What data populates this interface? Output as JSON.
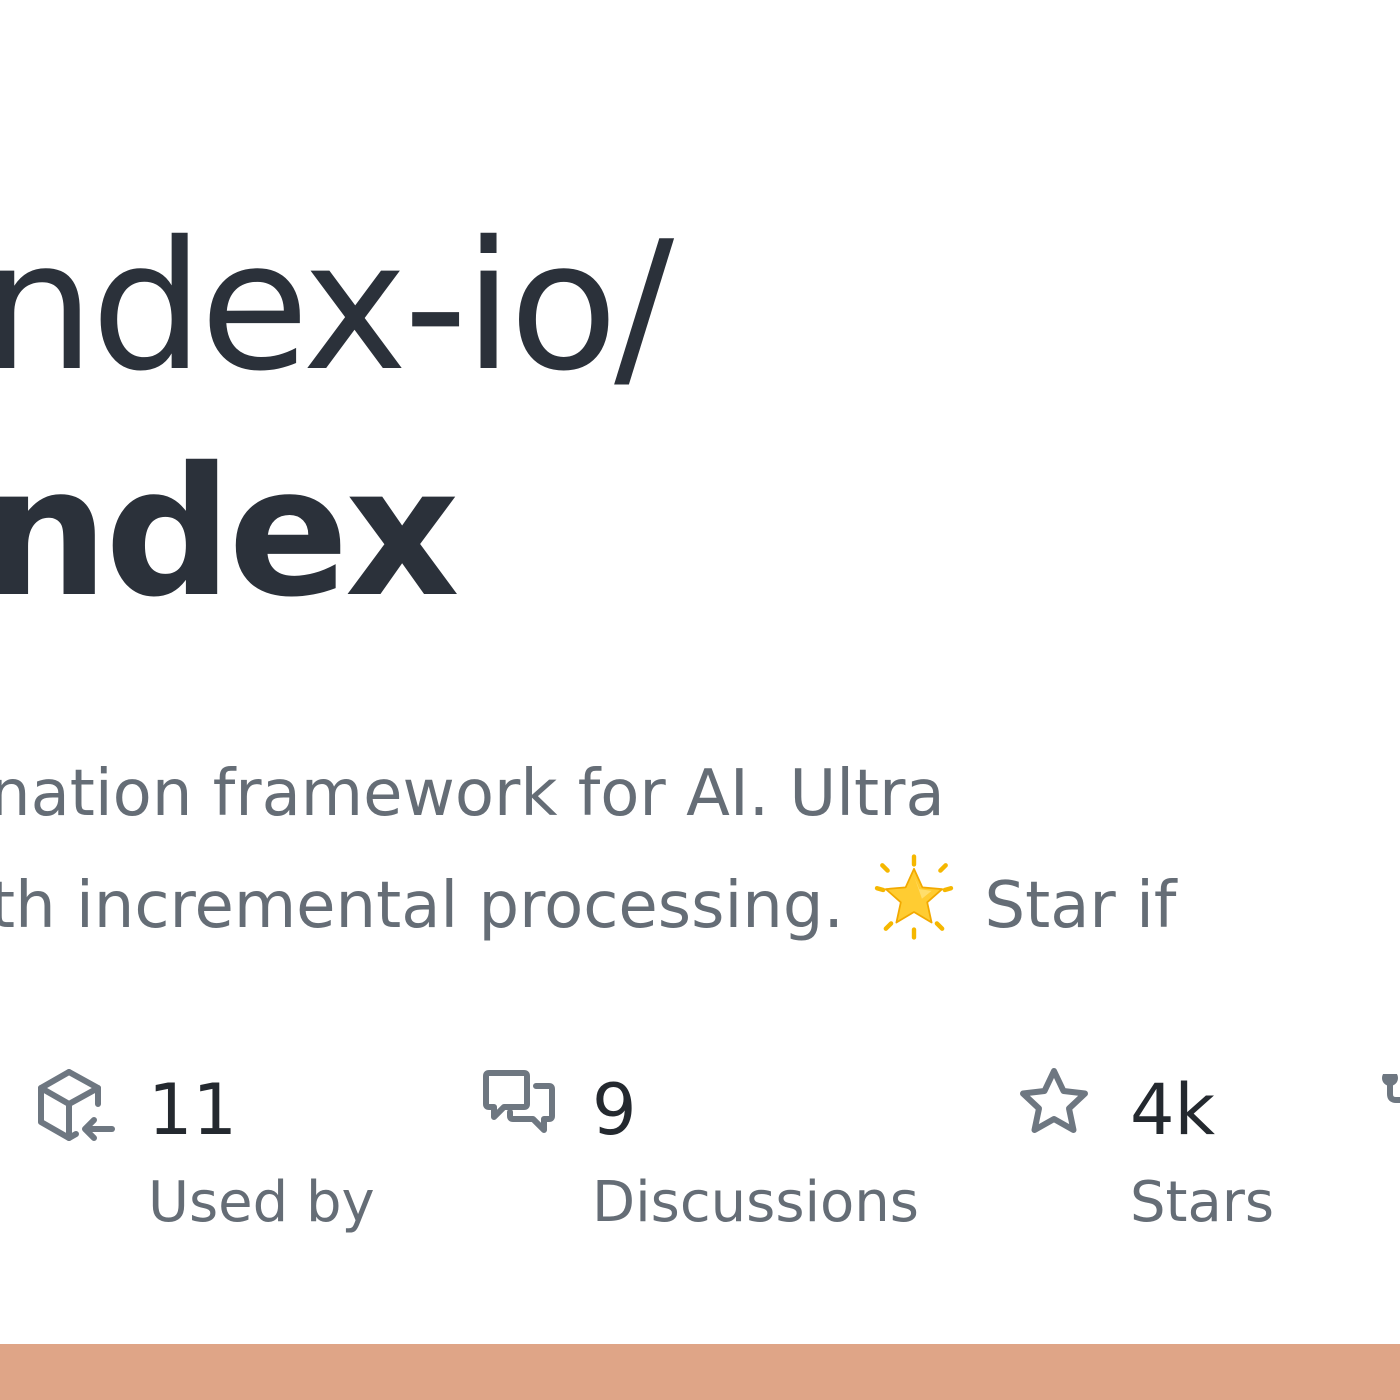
{
  "repo": {
    "owner": "ndex-io/",
    "name": "ndex"
  },
  "description": {
    "line1": "nation framework for AI. Ultra",
    "line2_before": "th incremental processing.",
    "line2_after": "Star if",
    "emoji_icon": "glowing-star-icon"
  },
  "stats": [
    {
      "icon": "package-dependents-icon",
      "value": "11",
      "label": "Used by"
    },
    {
      "icon": "comment-discussion-icon",
      "value": "9",
      "label": "Discussions"
    },
    {
      "icon": "star-icon",
      "value": "4k",
      "label": "Stars"
    }
  ],
  "colors": {
    "accent_bar": "#dfa587",
    "title": "#2b313a",
    "muted": "#656d76",
    "icon": "#6e7781"
  }
}
